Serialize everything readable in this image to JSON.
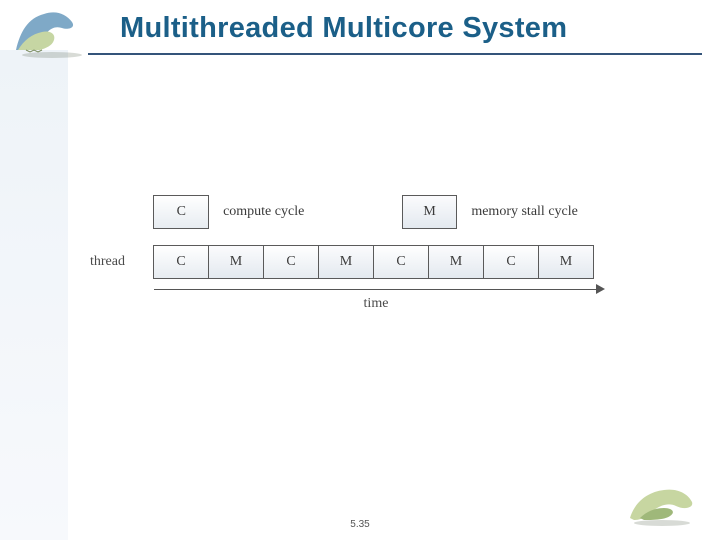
{
  "slide": {
    "title": "Multithreaded Multicore System",
    "page_number": "5.35"
  },
  "legend": {
    "compute_symbol": "C",
    "compute_label": "compute cycle",
    "memory_symbol": "M",
    "memory_label": "memory stall cycle"
  },
  "thread": {
    "label": "thread",
    "cells": [
      "C",
      "M",
      "C",
      "M",
      "C",
      "M",
      "C",
      "M"
    ]
  },
  "axis": {
    "time_label": "time"
  }
}
